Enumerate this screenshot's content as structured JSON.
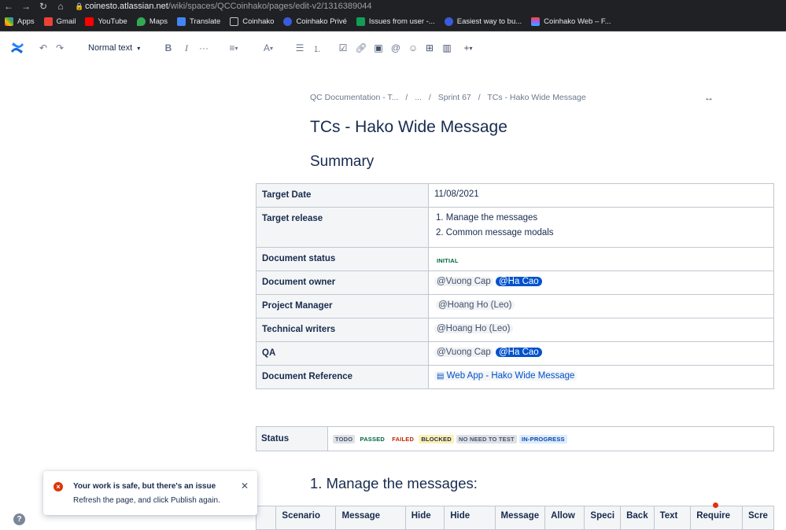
{
  "browser": {
    "url_host": "coinesto.atlassian.net",
    "url_path": "/wiki/spaces/QCCoinhako/pages/edit-v2/1316389044",
    "bookmarks": [
      "Apps",
      "Gmail",
      "YouTube",
      "Maps",
      "Translate",
      "Coinhako",
      "Coinhako Privé",
      "Issues from user -...",
      "Easiest way to bu...",
      "Coinhako Web – F..."
    ]
  },
  "toolbar": {
    "text_style": "Normal text"
  },
  "breadcrumb": {
    "space": "QC Documentation - T...",
    "ellipsis": "...",
    "parent": "Sprint 67",
    "current": "TCs - Hako Wide Message",
    "sep": "/"
  },
  "page": {
    "title": "TCs - Hako Wide Message",
    "summary_heading": "Summary",
    "section1_heading": "1. Manage the messages:"
  },
  "summary_table": {
    "target_date_label": "Target Date",
    "target_date": "11/08/2021",
    "target_release_label": "Target release",
    "release_items": [
      "1. Manage the messages",
      "2. Common message modals"
    ],
    "doc_status_label": "Document status",
    "doc_status": "INITIAL",
    "doc_owner_label": "Document owner",
    "doc_owner_1": "@Vuong Cap",
    "doc_owner_2": "@Ha Cao",
    "pm_label": "Project Manager",
    "pm": "@Hoang Ho (Leo)",
    "tw_label": "Technical writers",
    "tw": "@Hoang Ho (Leo)",
    "qa_label": "QA",
    "qa_1": "@Vuong Cap",
    "qa_2": "@Ha Cao",
    "doc_ref_label": "Document Reference",
    "doc_ref": "Web App - Hako Wide Message"
  },
  "status_table": {
    "label": "Status",
    "statuses": [
      "TODO",
      "PASSED",
      "FAILED",
      "BLOCKED",
      "NO NEED TO TEST",
      "IN-PROGRESS"
    ]
  },
  "tc_table": {
    "headers": [
      "",
      "Scenario",
      "Message",
      "Hide",
      "Hide",
      "Message",
      "Allow",
      "Speci",
      "Back",
      "Text",
      "Require",
      "Scre"
    ]
  },
  "toast": {
    "title": "Your work is safe, but there's an issue",
    "body": "Refresh the page, and click Publish again."
  },
  "help": "?",
  "colors": {
    "accent": "#0052cc",
    "error": "#de350b"
  }
}
